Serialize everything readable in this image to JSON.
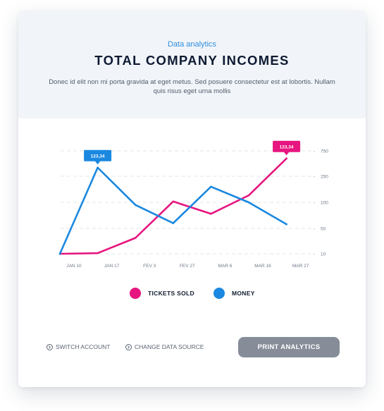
{
  "header": {
    "eyebrow": "Data analytics",
    "title": "TOTAL COMPANY INCOMES",
    "description": "Donec id elit non mi porta gravida at eget metus. Sed posuere consectetur est at lobortis. Nullam quis risus eget urna mollis"
  },
  "chart_data": {
    "type": "line",
    "categories": [
      "JAN 10",
      "JAN 17",
      "FEV 3",
      "FEV 27",
      "MAR 6",
      "MAR 16",
      "MAR 27"
    ],
    "y_ticks": [
      "750",
      "250",
      "100",
      "50",
      "10"
    ],
    "grid": true,
    "series": [
      {
        "name": "TICKETS SOLD",
        "color": "#e6157f",
        "x": [
          0,
          1,
          2,
          3,
          4,
          5,
          6
        ],
        "y": [
          10,
          11,
          35,
          105,
          78,
          140,
          600
        ],
        "callout": {
          "text": "123,34",
          "index": 6
        }
      },
      {
        "name": "MONEY",
        "color": "#1a88e0",
        "x": [
          0,
          1,
          2,
          3,
          4,
          5,
          6
        ],
        "y": [
          10,
          420,
          95,
          60,
          190,
          100,
          58
        ],
        "callout": {
          "text": "123,34",
          "index": 1
        }
      }
    ]
  },
  "legend": {
    "items": [
      {
        "label": "TICKETS SOLD",
        "color": "#e6157f"
      },
      {
        "label": "MONEY",
        "color": "#1a88e0"
      }
    ]
  },
  "footer": {
    "switch_account": "SWITCH ACCOUNT",
    "change_data_source": "CHANGE DATA SOURCE",
    "print_label": "PRINT ANALYTICS"
  }
}
